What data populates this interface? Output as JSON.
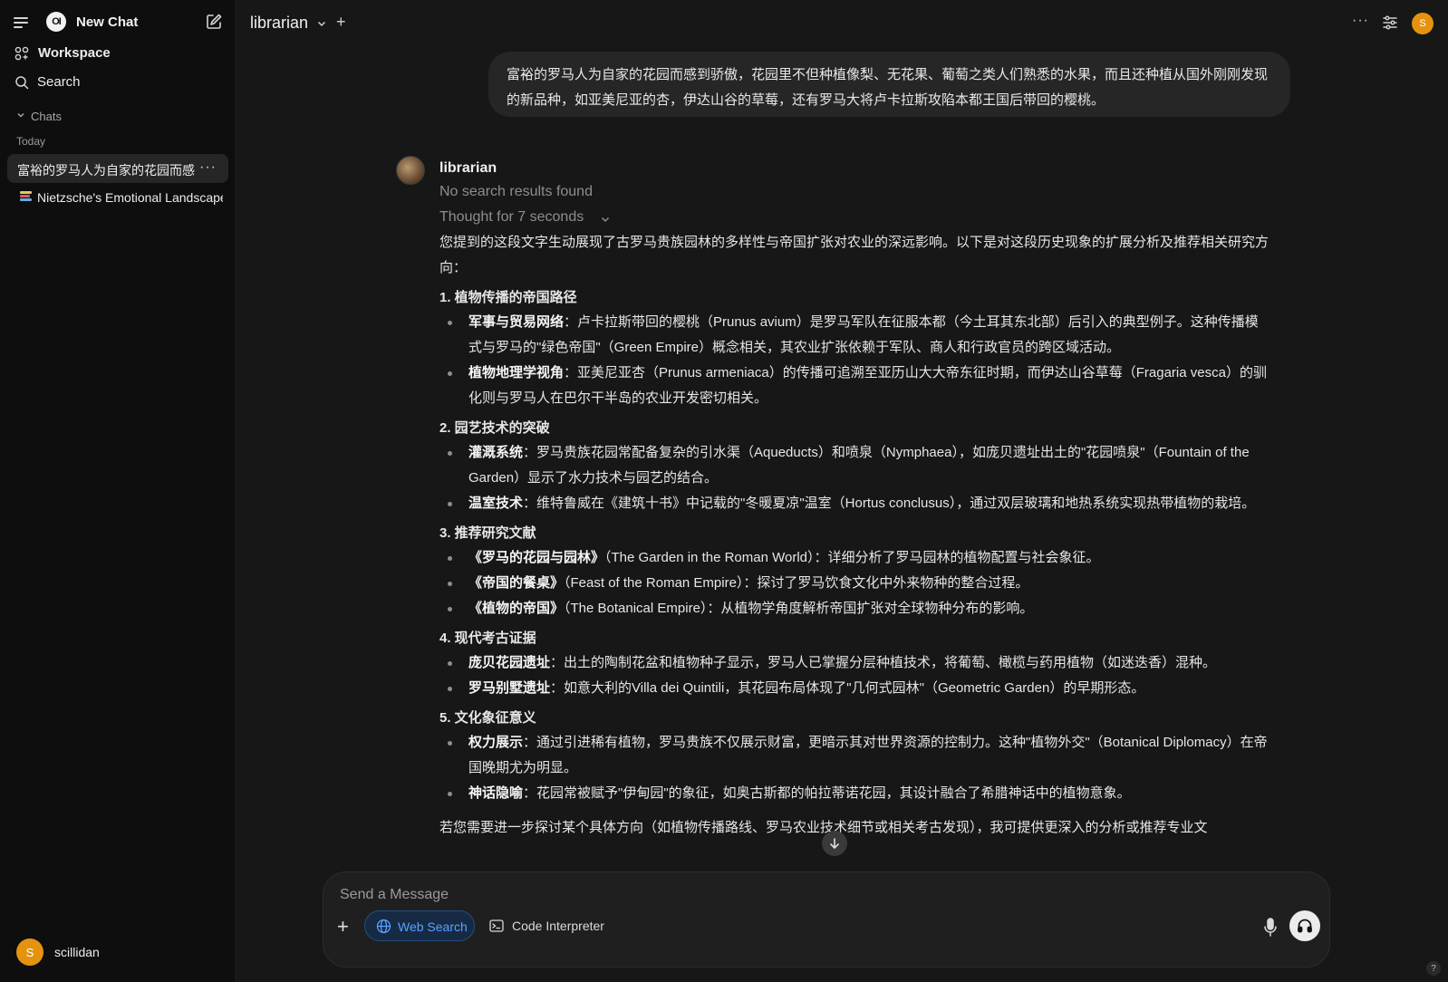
{
  "sidebar": {
    "new_chat": "New Chat",
    "workspace": "Workspace",
    "search": "Search",
    "chats_header": "Chats",
    "today_label": "Today",
    "chats": [
      {
        "title": "富裕的罗马人为自家的花园而感到骄傲",
        "more": "···"
      },
      {
        "title": "Nietzsche's Emotional Landscape"
      }
    ],
    "user": {
      "initial": "S",
      "name": "scillidan"
    }
  },
  "header": {
    "model": "librarian",
    "add": "+",
    "more": "···",
    "avatar_initial": "S"
  },
  "user_message": "富裕的罗马人为自家的花园而感到骄傲，花园里不但种植像梨、无花果、葡萄之类人们熟悉的水果，而且还种植从国外刚刚发现的新品种，如亚美尼亚的杏，伊达山谷的草莓，还有罗马大将卢卡拉斯攻陷本都王国后带回的樱桃。",
  "assistant": {
    "name": "librarian",
    "status": "No search results found",
    "thought": "Thought for 7 seconds",
    "intro": "您提到的这段文字生动展现了古罗马贵族园林的多样性与帝国扩张对农业的深远影响。以下是对这段历史现象的扩展分析及推荐相关研究方向：",
    "sections": [
      {
        "title": "1. 植物传播的帝国路径",
        "items": [
          {
            "term": "军事与贸易网络",
            "text": "：卢卡拉斯带回的樱桃（Prunus avium）是罗马军队在征服本都（今土耳其东北部）后引入的典型例子。这种传播模式与罗马的\"绿色帝国\"（Green Empire）概念相关，其农业扩张依赖于军队、商人和行政官员的跨区域活动。"
          },
          {
            "term": "植物地理学视角",
            "text": "：亚美尼亚杏（Prunus armeniaca）的传播可追溯至亚历山大大帝东征时期，而伊达山谷草莓（Fragaria vesca）的驯化则与罗马人在巴尔干半岛的农业开发密切相关。"
          }
        ]
      },
      {
        "title": "2. 园艺技术的突破",
        "items": [
          {
            "term": "灌溉系统",
            "text": "：罗马贵族花园常配备复杂的引水渠（Aqueducts）和喷泉（Nymphaea），如庞贝遗址出土的\"花园喷泉\"（Fountain of the Garden）显示了水力技术与园艺的结合。"
          },
          {
            "term": "温室技术",
            "text": "：维特鲁威在《建筑十书》中记载的\"冬暖夏凉\"温室（Hortus conclusus），通过双层玻璃和地热系统实现热带植物的栽培。"
          }
        ]
      },
      {
        "title": "3. 推荐研究文献",
        "items": [
          {
            "term": "《罗马的花园与园林》",
            "text": "（The Garden in the Roman World）：详细分析了罗马园林的植物配置与社会象征。"
          },
          {
            "term": "《帝国的餐桌》",
            "text": "（Feast of the Roman Empire）：探讨了罗马饮食文化中外来物种的整合过程。"
          },
          {
            "term": "《植物的帝国》",
            "text": "（The Botanical Empire）：从植物学角度解析帝国扩张对全球物种分布的影响。"
          }
        ]
      },
      {
        "title": "4. 现代考古证据",
        "items": [
          {
            "term": "庞贝花园遗址",
            "text": "：出土的陶制花盆和植物种子显示，罗马人已掌握分层种植技术，将葡萄、橄榄与药用植物（如迷迭香）混种。"
          },
          {
            "term": "罗马别墅遗址",
            "text": "：如意大利的Villa dei Quintili，其花园布局体现了\"几何式园林\"（Geometric Garden）的早期形态。"
          }
        ]
      },
      {
        "title": "5. 文化象征意义",
        "items": [
          {
            "term": "权力展示",
            "text": "：通过引进稀有植物，罗马贵族不仅展示财富，更暗示其对世界资源的控制力。这种\"植物外交\"（Botanical Diplomacy）在帝国晚期尤为明显。"
          },
          {
            "term": "神话隐喻",
            "text": "：花园常被赋予\"伊甸园\"的象征，如奥古斯都的帕拉蒂诺花园，其设计融合了希腊神话中的植物意象。"
          }
        ]
      }
    ],
    "outro": "若您需要进一步探讨某个具体方向（如植物传播路线、罗马农业技术细节或相关考古发现），我可提供更深入的分析或推荐专业文"
  },
  "composer": {
    "placeholder": "Send a Message",
    "web_search": "Web Search",
    "code_interpreter": "Code Interpreter"
  },
  "help": "?",
  "colors": {
    "background": "#171717",
    "sidebar": "#0e0e0e",
    "accent_blue": "#5aa1ff",
    "avatar_orange": "#e5930f"
  }
}
